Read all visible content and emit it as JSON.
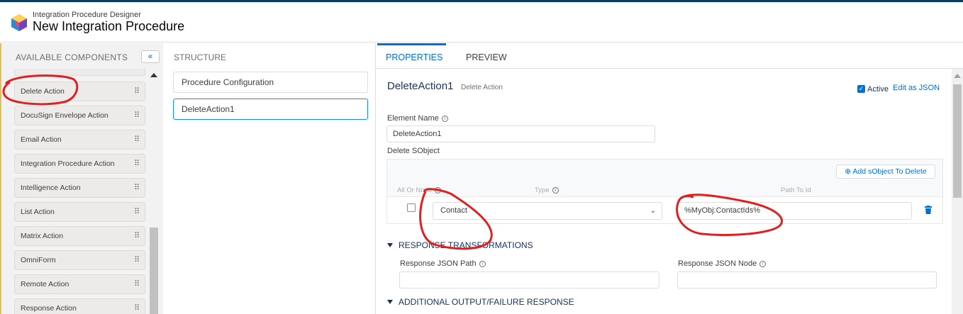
{
  "header": {
    "app_name": "Integration Procedure Designer",
    "procedure_title": "New Integration Procedure",
    "logo_icon": "omnistudio-cube-icon"
  },
  "components_panel": {
    "title": "AVAILABLE COMPONENTS",
    "collapse_label": "«",
    "items": [
      {
        "label": "Delete Action"
      },
      {
        "label": "DocuSign Envelope Action"
      },
      {
        "label": "Email Action"
      },
      {
        "label": "Integration Procedure Action"
      },
      {
        "label": "Intelligence Action"
      },
      {
        "label": "List Action"
      },
      {
        "label": "Matrix Action"
      },
      {
        "label": "OmniForm"
      },
      {
        "label": "Remote Action"
      },
      {
        "label": "Response Action"
      }
    ]
  },
  "structure_panel": {
    "title": "STRUCTURE",
    "nodes": [
      {
        "label": "Procedure Configuration"
      },
      {
        "label": "DeleteAction1"
      }
    ]
  },
  "tabs": {
    "properties": "PROPERTIES",
    "preview": "PREVIEW"
  },
  "properties": {
    "element_title": "DeleteAction1",
    "element_type": "Delete Action",
    "active_label": "Active",
    "active_checked": true,
    "edit_json": "Edit as JSON",
    "element_name_label": "Element Name",
    "element_name_value": "DeleteAction1",
    "delete_sobject_label": "Delete SObject",
    "add_sobject_button": "⊕ Add sObject To Delete",
    "columns": {
      "all_or_none": "All Or None",
      "type": "Type",
      "path_to_id": "Path To Id"
    },
    "row": {
      "type_value": "Contact",
      "path_value": "%MyObj:ContactIds%"
    },
    "response_section": "RESPONSE TRANSFORMATIONS",
    "response_json_path_label": "Response JSON Path",
    "response_json_node_label": "Response JSON Node",
    "additional_section": "ADDITIONAL OUTPUT/FAILURE RESPONSE"
  },
  "colors": {
    "accent": "#0070d2",
    "annotation": "#e02020"
  }
}
